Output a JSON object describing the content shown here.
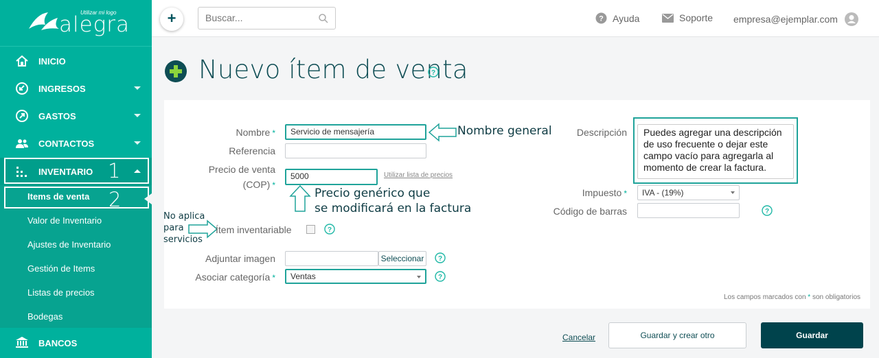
{
  "logo": {
    "tagline": "Utilizar mi logo",
    "brand": "alegra"
  },
  "sidebar": {
    "items": [
      {
        "label": "INICIO"
      },
      {
        "label": "INGRESOS"
      },
      {
        "label": "GASTOS"
      },
      {
        "label": "CONTACTOS"
      },
      {
        "label": "INVENTARIO"
      },
      {
        "label": "BANCOS"
      }
    ],
    "submenu": [
      {
        "label": "Items de venta"
      },
      {
        "label": "Valor de Inventario"
      },
      {
        "label": "Ajustes de Inventario"
      },
      {
        "label": "Gestión de Items"
      },
      {
        "label": "Listas de precios"
      },
      {
        "label": "Bodegas"
      }
    ],
    "marker_1": "1",
    "marker_2": "2"
  },
  "topbar": {
    "search_placeholder": "Buscar...",
    "help": "Ayuda",
    "support": "Soporte",
    "user_email": "empresa@ejemplar.com"
  },
  "page": {
    "title": "Nuevo ítem de venta"
  },
  "form": {
    "name_label": "Nombre",
    "name_value": "Servicio de mensajería",
    "reference_label": "Referencia",
    "reference_value": "",
    "price_label_1": "Precio de venta",
    "price_label_2": "(COP)",
    "price_value": "5000",
    "price_list_link": "Utilizar lista de precios",
    "inventory_label": "Ítem inventariable",
    "image_label": "Adjuntar imagen",
    "image_button": "Seleccionar",
    "category_label": "Asociar categoría",
    "category_value": "Ventas",
    "description_label": "Descripción",
    "description_value": "Puedes agregar una descripción de uso frecuente o dejar este campo vacío para agregarla al momento de crear la factura.",
    "tax_label": "Impuesto",
    "tax_value": "IVA - (19%)",
    "barcode_label": "Código de barras",
    "barcode_value": "",
    "required_note_a": "Los campos marcados con",
    "required_star": "*",
    "required_note_b": "son obligatorios"
  },
  "annotations": {
    "general_name": "Nombre general",
    "generic_price_1": "Precio genérico que",
    "generic_price_2": "se modificará en la factura",
    "no_apply_1": "No aplica",
    "no_apply_2": "para",
    "no_apply_3": "servicios"
  },
  "actions": {
    "cancel": "Cancelar",
    "save_and_new": "Guardar y crear otro",
    "save": "Guardar"
  },
  "colors": {
    "sidebar": "#00b19d",
    "primary_dark": "#00434c",
    "title": "#0e4d54",
    "highlight_border": "#1fa39a"
  }
}
